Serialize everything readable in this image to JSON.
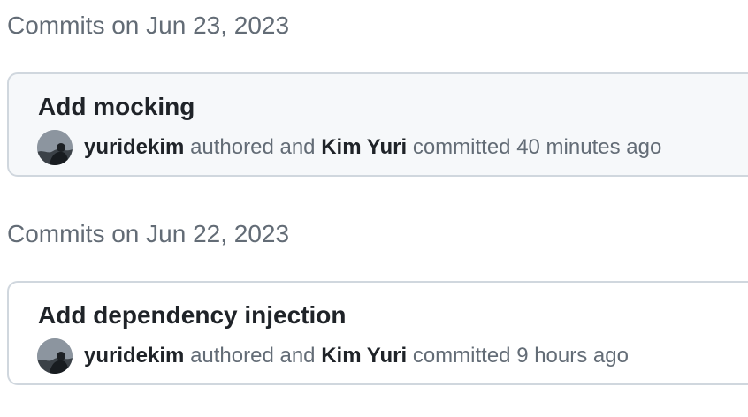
{
  "groups": [
    {
      "heading": "Commits on Jun 23, 2023",
      "commits": [
        {
          "title": "Add mocking",
          "author": "yuridekim",
          "authored_text": "authored and",
          "committer": "Kim Yuri",
          "committed_text": "committed",
          "time": "40 minutes ago"
        }
      ]
    },
    {
      "heading": "Commits on Jun 22, 2023",
      "commits": [
        {
          "title": "Add dependency injection",
          "author": "yuridekim",
          "authored_text": "authored and",
          "committer": "Kim Yuri",
          "committed_text": "committed",
          "time": "9 hours ago"
        }
      ]
    }
  ],
  "colors": {
    "muted_text": "#636c76",
    "primary_text": "#1f2328",
    "card_border": "#d0d7de",
    "highlight_card_bg": "#f6f8fa"
  }
}
